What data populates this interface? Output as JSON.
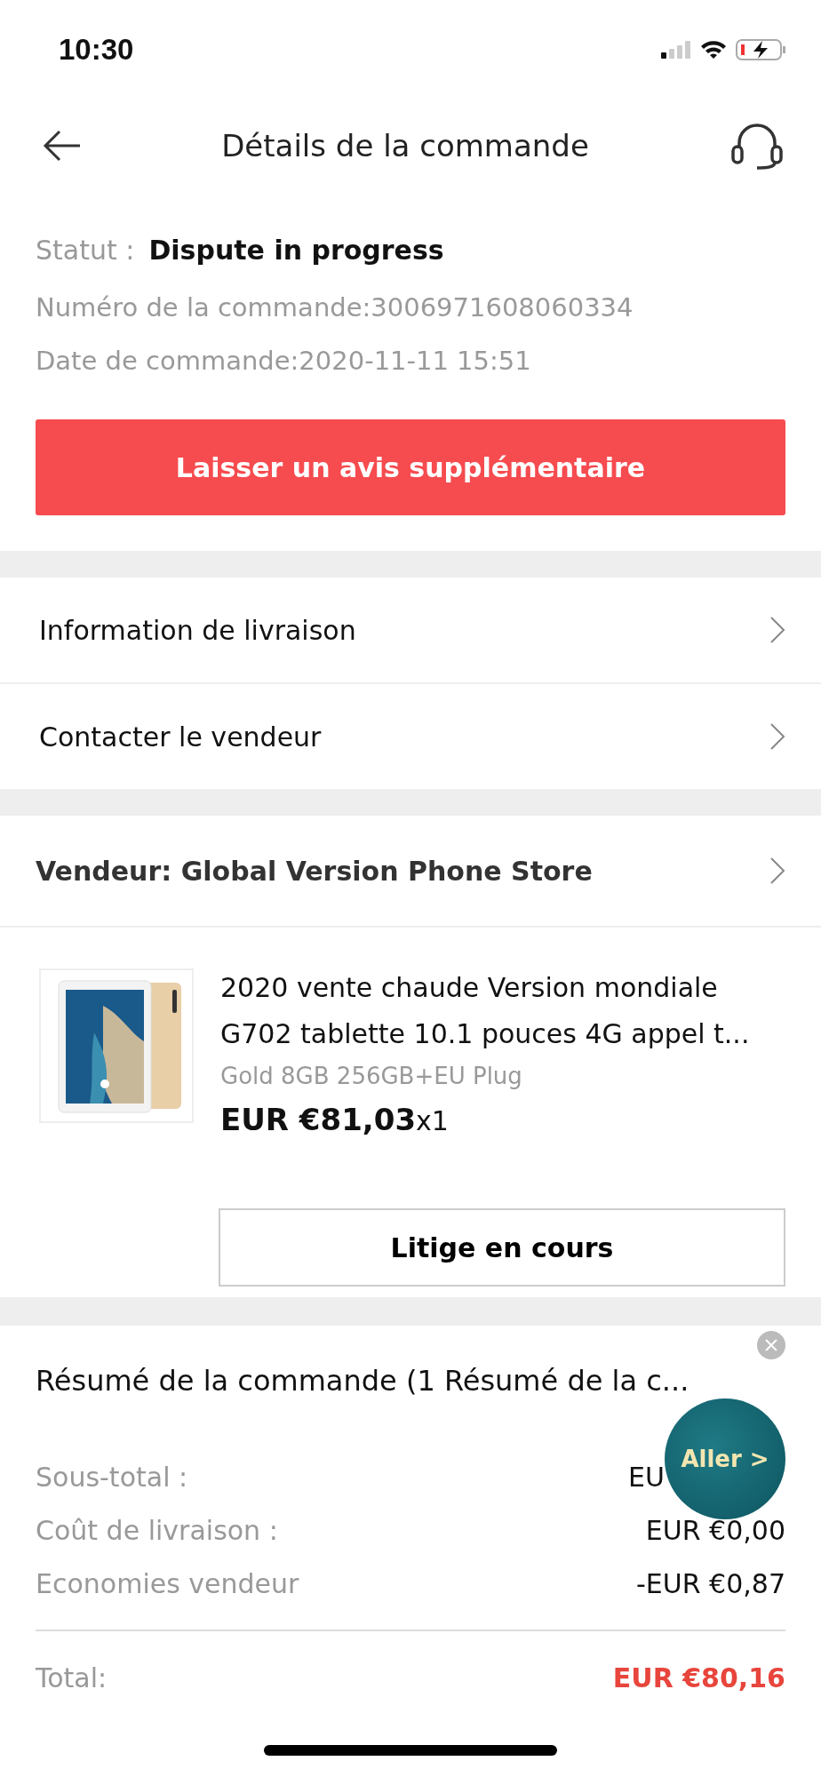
{
  "status_bar": {
    "time": "10:30"
  },
  "header": {
    "title": "Détails de la commande"
  },
  "order": {
    "status_label": "Statut :",
    "status": "Dispute in progress",
    "number": "Numéro de la commande:3006971608060334",
    "date": "Date de commande:2020-11-11 15:51"
  },
  "review_button": "Laisser un avis supplémentaire",
  "links": [
    "Information de livraison",
    "Contacter le vendeur"
  ],
  "seller": "Vendeur: Global Version Phone Store",
  "product": {
    "kind": "picture",
    "title": "2020 vente chaude Version mondiale G702 tablette 10.1 pouces 4G appel t...",
    "variant": "Gold 8GB 256GB+EU Plug",
    "price": "EUR €81,03",
    "quantity": "x1",
    "action": "Litige en cours"
  },
  "summary": {
    "title": "Résumé de la commande (1 Résumé de la c...",
    "rows": [
      {
        "label": "Sous-total :",
        "value": "EU",
        "covered": true
      },
      {
        "label": "Coût de livraison :",
        "value": "EUR €0,00",
        "covered": false
      },
      {
        "label": "Economies vendeur",
        "value": "-EUR €0,87",
        "covered": false
      }
    ],
    "total_label": "Total:",
    "total": "EUR €80,16"
  },
  "float_button": "Aller >"
}
